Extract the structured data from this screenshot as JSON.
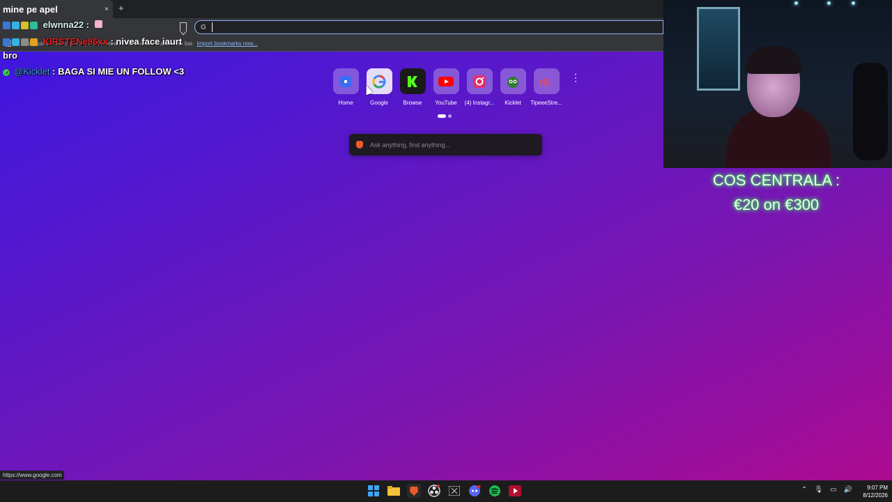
{
  "browser": {
    "tab_title": "mine pe apel",
    "tab_close": "×",
    "new_tab": "+",
    "omnibox_icon": "G",
    "bookmark_hint": "For quick access, place your bookmarks here on the bookmarks bar.",
    "bookmark_import": "Import bookmarks now..."
  },
  "chat": [
    {
      "user": "elwnna22",
      "sep": " :",
      "message": ""
    },
    {
      "user": "KIRSTENe86xx",
      "sep": " :",
      "message": " nivea face iaurt"
    },
    {
      "continuation": "bro"
    },
    {
      "user": "@Kicklet",
      "sep": " :",
      "message": " BAGA SI MIE UN FOLLOW <3"
    }
  ],
  "newtab": {
    "shortcuts": [
      {
        "label": "Home",
        "icon": "roblox-icon",
        "color": "#3a6cf4"
      },
      {
        "label": "Google",
        "icon": "google-icon",
        "color": "#4285f4"
      },
      {
        "label": "Browse",
        "icon": "kick-icon",
        "color": "#53fc18"
      },
      {
        "label": "YouTube",
        "icon": "youtube-icon",
        "color": "#ff0000"
      },
      {
        "label": "(4) Instagr...",
        "icon": "instagram-icon",
        "color": "#e1306c"
      },
      {
        "label": "Kicklet",
        "icon": "kicklet-icon",
        "color": "#2e7d32"
      },
      {
        "label": "TipeeeStre...",
        "icon": "tipeeestream-icon",
        "color": "#e84a5f"
      }
    ],
    "more_icon": "⋮",
    "search_placeholder": "Ask anything, find anything..."
  },
  "overlay": {
    "line1": "COS CENTRALA :",
    "line2": "€20 on €300"
  },
  "status_url": "https://www.google.com",
  "taskbar": {
    "icons": [
      "windows-start-icon",
      "file-explorer-icon",
      "brave-icon",
      "obs-icon",
      "xbox-icon",
      "discord-icon",
      "spotify-icon",
      "media-player-icon"
    ],
    "clock_time": "9:07 PM",
    "clock_date": "8/12/2026"
  }
}
